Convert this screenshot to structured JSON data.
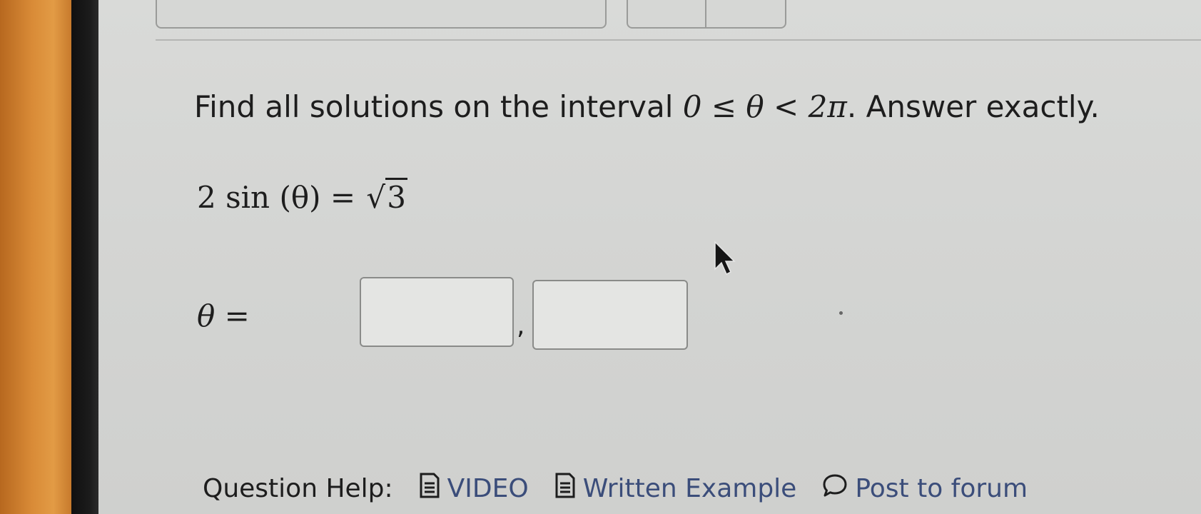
{
  "question": {
    "prefix": "Find all solutions on the interval ",
    "interval": "0 ≤ θ < 2π",
    "suffix": ". Answer exactly."
  },
  "equation": {
    "lhs": "2 sin (θ) = ",
    "radical_sign": "√",
    "radicand": "3"
  },
  "answer": {
    "variable_label": "θ =",
    "separator": ",",
    "input_1_value": "",
    "input_2_value": ""
  },
  "help": {
    "label": "Question Help:",
    "video_label": "VIDEO",
    "written_example_label": "Written Example",
    "forum_label": "Post to forum"
  },
  "icons": {
    "video": "document-icon",
    "written_example": "document-icon",
    "forum": "speech-bubble-icon",
    "pointer": "mouse-cursor-icon"
  },
  "colors": {
    "link": "#3b4d7a",
    "text": "#1d1d1d",
    "input_border": "#8a8b89"
  }
}
